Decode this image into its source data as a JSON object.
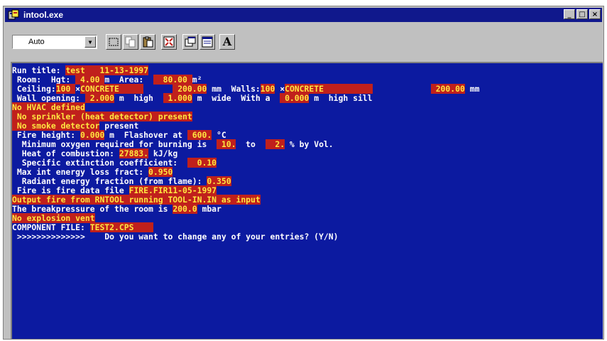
{
  "window": {
    "title": "intool.exe",
    "controls": [
      "_",
      "□",
      "×"
    ]
  },
  "toolbar": {
    "font_value": "Auto",
    "a_label": "A"
  },
  "console": {
    "lines": [
      [
        {
          "t": "Run title: "
        },
        {
          "t": "test   11-13-1997",
          "h": 1
        }
      ],
      [
        {
          "t": " Room:  Hgt: "
        },
        {
          "t": " 4.00 ",
          "h": 1
        },
        {
          "t": "m  Area:  "
        },
        {
          "t": "  80.00 ",
          "h": 1
        },
        {
          "t": "m²"
        }
      ],
      [
        {
          "t": " Ceiling:"
        },
        {
          "t": "100 ",
          "h": 1
        },
        {
          "t": "×"
        },
        {
          "t": "CONCRETE     ",
          "h": 1
        },
        {
          "t": "      "
        },
        {
          "t": " 200.00",
          "h": 1
        },
        {
          "t": " mm  Walls:"
        },
        {
          "t": "100",
          "h": 1
        },
        {
          "t": " ×"
        },
        {
          "t": "CONCRETE          ",
          "h": 1
        },
        {
          "t": "            "
        },
        {
          "t": " 200.00",
          "h": 1
        },
        {
          "t": " mm"
        }
      ],
      [
        {
          "t": " Wall opening: "
        },
        {
          "t": " 2.000",
          "h": 1
        },
        {
          "t": " m  high  "
        },
        {
          "t": " 1.000",
          "h": 1
        },
        {
          "t": " m  wide  With a  "
        },
        {
          "t": " 0.000",
          "h": 1
        },
        {
          "t": " m  high sill"
        }
      ],
      [
        {
          "t": "No HVAC defined",
          "h": 1
        }
      ],
      [
        {
          "t": " No sprinkler (heat detector) present",
          "h": 1,
          "r": 24
        }
      ],
      [
        {
          "t": " No smoke detector",
          "h": 1
        },
        {
          "t": " present"
        }
      ],
      [
        {
          "t": " Fire height: "
        },
        {
          "t": "0.000",
          "h": 1
        },
        {
          "t": " m  Flashover at "
        },
        {
          "t": " 600.",
          "h": 1
        },
        {
          "t": " °C"
        }
      ],
      [
        {
          "t": "  Minimum oxygen required for burning is  "
        },
        {
          "t": " 10.",
          "h": 1
        },
        {
          "t": "  to  "
        },
        {
          "t": "  2.",
          "h": 1
        },
        {
          "t": " % by Vol."
        }
      ],
      [
        {
          "t": "  Heat of combustion: "
        },
        {
          "t": "27883.",
          "h": 1
        },
        {
          "t": " kJ/kg"
        }
      ],
      [
        {
          "t": "  Specific extinction coefficient:  "
        },
        {
          "t": "  0.10",
          "h": 1
        }
      ],
      [
        {
          "t": " Max int energy loss fract: "
        },
        {
          "t": "0.950",
          "h": 1
        }
      ],
      [
        {
          "t": "  Radiant energy fraction (from flame): "
        },
        {
          "t": "0.350",
          "h": 1
        }
      ],
      [
        {
          "t": " Fire is fire data file "
        },
        {
          "t": "FIRE.FIR11-05-1997",
          "h": 1
        }
      ],
      [
        {
          "t": "Output fire from RNTOOL running TOOL-IN.IN as input",
          "h": 1
        }
      ],
      [
        {
          "t": "The breakpressure of the room is "
        },
        {
          "t": "200.0",
          "h": 1
        },
        {
          "t": " mbar"
        }
      ],
      [
        {
          "t": "No explosion vent",
          "h": 1
        }
      ],
      [
        {
          "t": "COMPONENT FILE: "
        },
        {
          "t": "TEST2.CPS    ",
          "h": 1
        }
      ],
      [
        {
          "t": " >>>>>>>>>>>>>>    Do you want to change any of your entries? (Y/N)"
        }
      ]
    ]
  }
}
